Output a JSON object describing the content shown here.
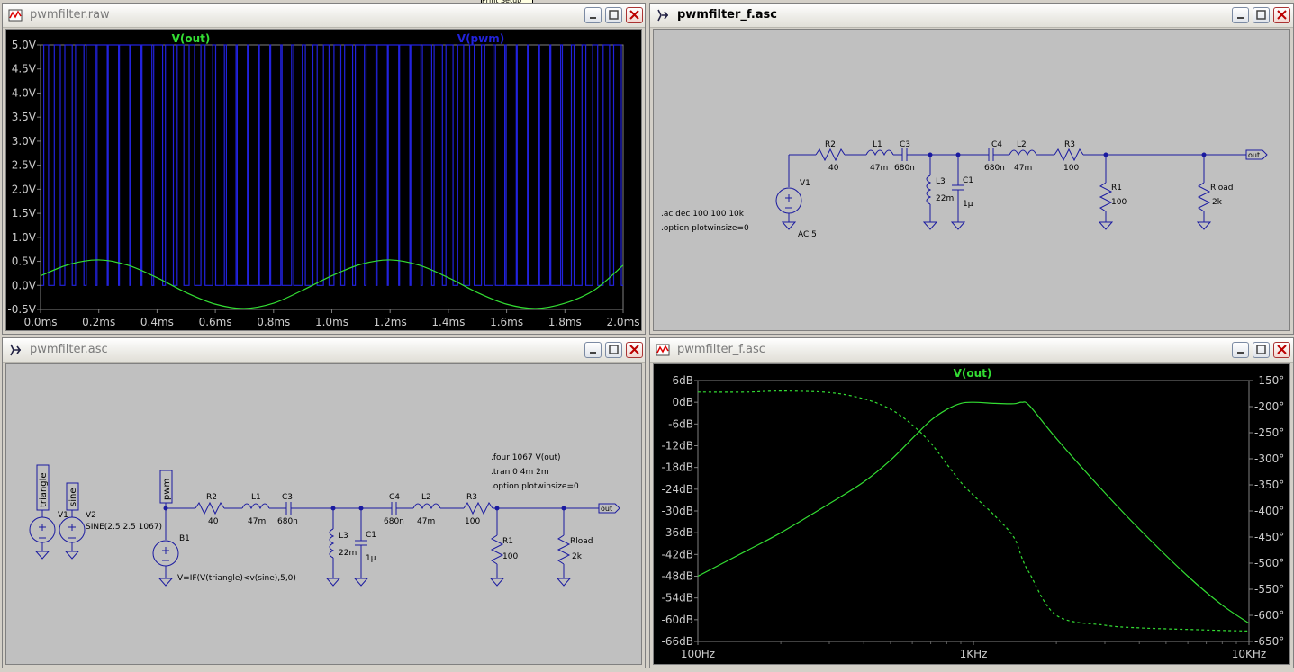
{
  "tooltip": "Print Setup",
  "windows": {
    "raw_plot": {
      "title": "pwmfilter.raw",
      "traces": [
        {
          "name": "V(out)",
          "color": "#33dd33"
        },
        {
          "name": "V(pwm)",
          "color": "#2222dd"
        }
      ],
      "y_ticks": [
        "5.0V",
        "4.5V",
        "4.0V",
        "3.5V",
        "3.0V",
        "2.5V",
        "2.0V",
        "1.5V",
        "1.0V",
        "0.5V",
        "0.0V",
        "-0.5V"
      ],
      "x_ticks": [
        "0.0ms",
        "0.2ms",
        "0.4ms",
        "0.6ms",
        "0.8ms",
        "1.0ms",
        "1.2ms",
        "1.4ms",
        "1.6ms",
        "1.8ms",
        "2.0ms"
      ]
    },
    "ac_schematic": {
      "title": "pwmfilter_f.asc",
      "labels": {
        "r2": "R2",
        "r2v": "40",
        "l1": "L1",
        "l1v": "47m",
        "c3": "C3",
        "c3v": "680n",
        "c4": "C4",
        "c4v": "680n",
        "l2": "L2",
        "l2v": "47m",
        "r3": "R3",
        "r3v": "100",
        "l3": "L3",
        "l3v": "22m",
        "c1": "C1",
        "c1v": "1µ",
        "r1": "R1",
        "r1v": "100",
        "rload": "Rload",
        "rloadv": "2k",
        "v1": "V1",
        "v1v": "AC 5",
        "out": "out",
        "dir1": ".ac dec 100 100 10k",
        "dir2": ".option plotwinsize=0"
      }
    },
    "tran_schematic": {
      "title": "pwmfilter.asc",
      "labels": {
        "triangle": "triangle",
        "sine": "sine",
        "pwm": "pwm",
        "v1": "V1",
        "v2": "V2",
        "v2v": "SINE(2.5 2.5 1067)",
        "b1": "B1",
        "b1v": "V=IF(V(triangle)<v(sine),5,0)",
        "r2": "R2",
        "r2v": "40",
        "l1": "L1",
        "l1v": "47m",
        "c3": "C3",
        "c3v": "680n",
        "c4": "C4",
        "c4v": "680n",
        "l2": "L2",
        "l2v": "47m",
        "r3": "R3",
        "r3v": "100",
        "l3": "L3",
        "l3v": "22m",
        "c1": "C1",
        "c1v": "1µ",
        "r1": "R1",
        "r1v": "100",
        "rload": "Rload",
        "rloadv": "2k",
        "out": "out",
        "dir1": ".four 1067 V(out)",
        "dir2": ".tran 0 4m 2m",
        "dir3": ".option plotwinsize=0"
      }
    },
    "ac_plot": {
      "title": "pwmfilter_f.asc",
      "trace": {
        "name": "V(out)",
        "color": "#33dd33"
      },
      "y_left_ticks": [
        "6dB",
        "0dB",
        "-6dB",
        "-12dB",
        "-18dB",
        "-24dB",
        "-30dB",
        "-36dB",
        "-42dB",
        "-48dB",
        "-54dB",
        "-60dB",
        "-66dB"
      ],
      "y_right_ticks": [
        "-150°",
        "-200°",
        "-250°",
        "-300°",
        "-350°",
        "-400°",
        "-450°",
        "-500°",
        "-550°",
        "-600°",
        "-650°"
      ],
      "x_ticks": [
        "100Hz",
        "1KHz",
        "10KHz"
      ]
    }
  },
  "chart_data": [
    {
      "type": "line",
      "title": "",
      "xlabel": "",
      "ylabel": "",
      "xlim": [
        0.0,
        2.0
      ],
      "ylim": [
        -0.5,
        5.0
      ],
      "x_unit": "ms",
      "y_unit": "V",
      "grid": false,
      "legend": "top",
      "series": [
        {
          "name": "V(out)",
          "x": [
            0.0,
            0.1,
            0.2,
            0.3,
            0.4,
            0.5,
            0.6,
            0.7,
            0.8,
            0.9,
            1.0,
            1.1,
            1.2,
            1.3,
            1.4,
            1.5,
            1.6,
            1.7,
            1.8,
            1.9,
            2.0
          ],
          "values": [
            0.2,
            0.44,
            0.53,
            0.42,
            0.16,
            -0.15,
            -0.39,
            -0.48,
            -0.37,
            -0.1,
            0.2,
            0.44,
            0.53,
            0.42,
            0.16,
            -0.15,
            -0.39,
            -0.48,
            -0.37,
            -0.1,
            0.42
          ]
        },
        {
          "name": "V(pwm)",
          "low": 0.0,
          "high": 5.0,
          "carrier_pulses": 52
        }
      ]
    },
    {
      "type": "line",
      "title": "",
      "xlabel": "",
      "ylabel": "",
      "x_scale": "log",
      "xlim": [
        100,
        10000
      ],
      "ylim": [
        -66,
        6
      ],
      "y2lim": [
        -650,
        -150
      ],
      "grid": false,
      "legend": "top",
      "series": [
        {
          "name": "V(out)",
          "axis": "left",
          "style": "solid",
          "x": [
            100,
            150,
            200,
            300,
            400,
            500,
            600,
            700,
            800,
            900,
            1000,
            1200,
            1400,
            1500,
            1600,
            2000,
            3000,
            4000,
            6000,
            8000,
            10000
          ],
          "values": [
            -48,
            -41,
            -36,
            -28,
            -22,
            -16,
            -10,
            -5,
            -2,
            -0.3,
            0,
            -0.3,
            -0.4,
            0,
            -1,
            -10,
            -25,
            -35,
            -48,
            -56,
            -61
          ]
        },
        {
          "name": "V(out) phase",
          "axis": "right",
          "style": "dashed",
          "x": [
            100,
            150,
            200,
            300,
            400,
            500,
            600,
            700,
            800,
            900,
            1000,
            1200,
            1400,
            1500,
            1600,
            2000,
            3000,
            4000,
            6000,
            8000,
            10000
          ],
          "values": [
            -172,
            -172,
            -170,
            -173,
            -185,
            -205,
            -235,
            -270,
            -310,
            -345,
            -370,
            -410,
            -450,
            -490,
            -520,
            -600,
            -619,
            -624,
            -627,
            -629,
            -630
          ]
        }
      ]
    }
  ]
}
